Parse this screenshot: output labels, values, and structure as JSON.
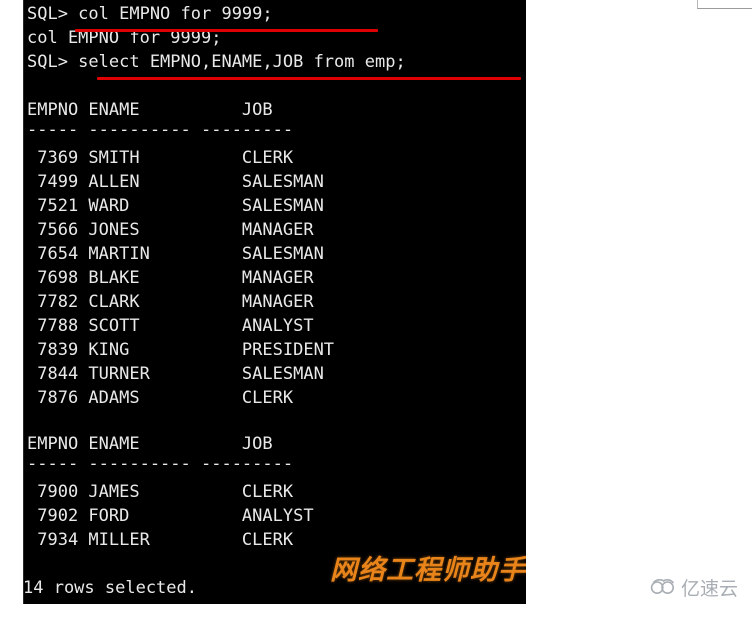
{
  "terminal": {
    "prompt": "SQL>",
    "lines": [
      {
        "id": "cmd-col-format",
        "text": "SQL> col EMPNO for 9999;"
      },
      {
        "id": "echo-col-format",
        "text": "col EMPNO for 9999;"
      },
      {
        "id": "cmd-select",
        "text": "SQL> select EMPNO,ENAME,JOB from emp;"
      },
      {
        "id": "blank-1",
        "text": ""
      },
      {
        "id": "header-1",
        "text": "EMPNO ENAME          JOB"
      },
      {
        "id": "separator-1",
        "text": "----- ---------- ---------"
      },
      {
        "id": "row-7369",
        "text": " 7369 SMITH          CLERK"
      },
      {
        "id": "row-7499",
        "text": " 7499 ALLEN          SALESMAN"
      },
      {
        "id": "row-7521",
        "text": " 7521 WARD           SALESMAN"
      },
      {
        "id": "row-7566",
        "text": " 7566 JONES          MANAGER"
      },
      {
        "id": "row-7654",
        "text": " 7654 MARTIN         SALESMAN"
      },
      {
        "id": "row-7698",
        "text": " 7698 BLAKE          MANAGER"
      },
      {
        "id": "row-7782",
        "text": " 7782 CLARK          MANAGER"
      },
      {
        "id": "row-7788",
        "text": " 7788 SCOTT          ANALYST"
      },
      {
        "id": "row-7839",
        "text": " 7839 KING           PRESIDENT"
      },
      {
        "id": "row-7844",
        "text": " 7844 TURNER         SALESMAN"
      },
      {
        "id": "row-7876",
        "text": " 7876 ADAMS          CLERK"
      },
      {
        "id": "blank-2",
        "text": ""
      },
      {
        "id": "header-2",
        "text": "EMPNO ENAME          JOB"
      },
      {
        "id": "separator-2",
        "text": "----- ---------- ---------"
      },
      {
        "id": "row-7900",
        "text": " 7900 JAMES          CLERK"
      },
      {
        "id": "row-7902",
        "text": " 7902 FORD           ANALYST"
      },
      {
        "id": "row-7934",
        "text": " 7934 MILLER         CLERK"
      },
      {
        "id": "blank-3",
        "text": ""
      },
      {
        "id": "rows-selected",
        "text": "14 rows selected."
      }
    ],
    "columns": [
      "EMPNO",
      "ENAME",
      "JOB"
    ],
    "rows": [
      {
        "empno": "7369",
        "ename": "SMITH",
        "job": "CLERK"
      },
      {
        "empno": "7499",
        "ename": "ALLEN",
        "job": "SALESMAN"
      },
      {
        "empno": "7521",
        "ename": "WARD",
        "job": "SALESMAN"
      },
      {
        "empno": "7566",
        "ename": "JONES",
        "job": "MANAGER"
      },
      {
        "empno": "7654",
        "ename": "MARTIN",
        "job": "SALESMAN"
      },
      {
        "empno": "7698",
        "ename": "BLAKE",
        "job": "MANAGER"
      },
      {
        "empno": "7782",
        "ename": "CLARK",
        "job": "MANAGER"
      },
      {
        "empno": "7788",
        "ename": "SCOTT",
        "job": "ANALYST"
      },
      {
        "empno": "7839",
        "ename": "KING",
        "job": "PRESIDENT"
      },
      {
        "empno": "7844",
        "ename": "TURNER",
        "job": "SALESMAN"
      },
      {
        "empno": "7876",
        "ename": "ADAMS",
        "job": "CLERK"
      },
      {
        "empno": "7900",
        "ename": "JAMES",
        "job": "CLERK"
      },
      {
        "empno": "7902",
        "ename": "FORD",
        "job": "ANALYST"
      },
      {
        "empno": "7934",
        "ename": "MILLER",
        "job": "CLERK"
      }
    ],
    "row_count_message": "14 rows selected.",
    "background_color": "#000000",
    "text_color": "#e9e9e9"
  },
  "annotations": {
    "underline_color": "#e00000",
    "underline_1_target": "col EMPNO for 9999;",
    "underline_2_target": "select EMPNO,ENAME,JOB from emp;"
  },
  "watermark": {
    "text": "网络工程师助手",
    "color": "#e8841a"
  },
  "site_logo": {
    "text": "亿速云",
    "icon": "cloud-icon",
    "color": "#a8aeb4"
  }
}
